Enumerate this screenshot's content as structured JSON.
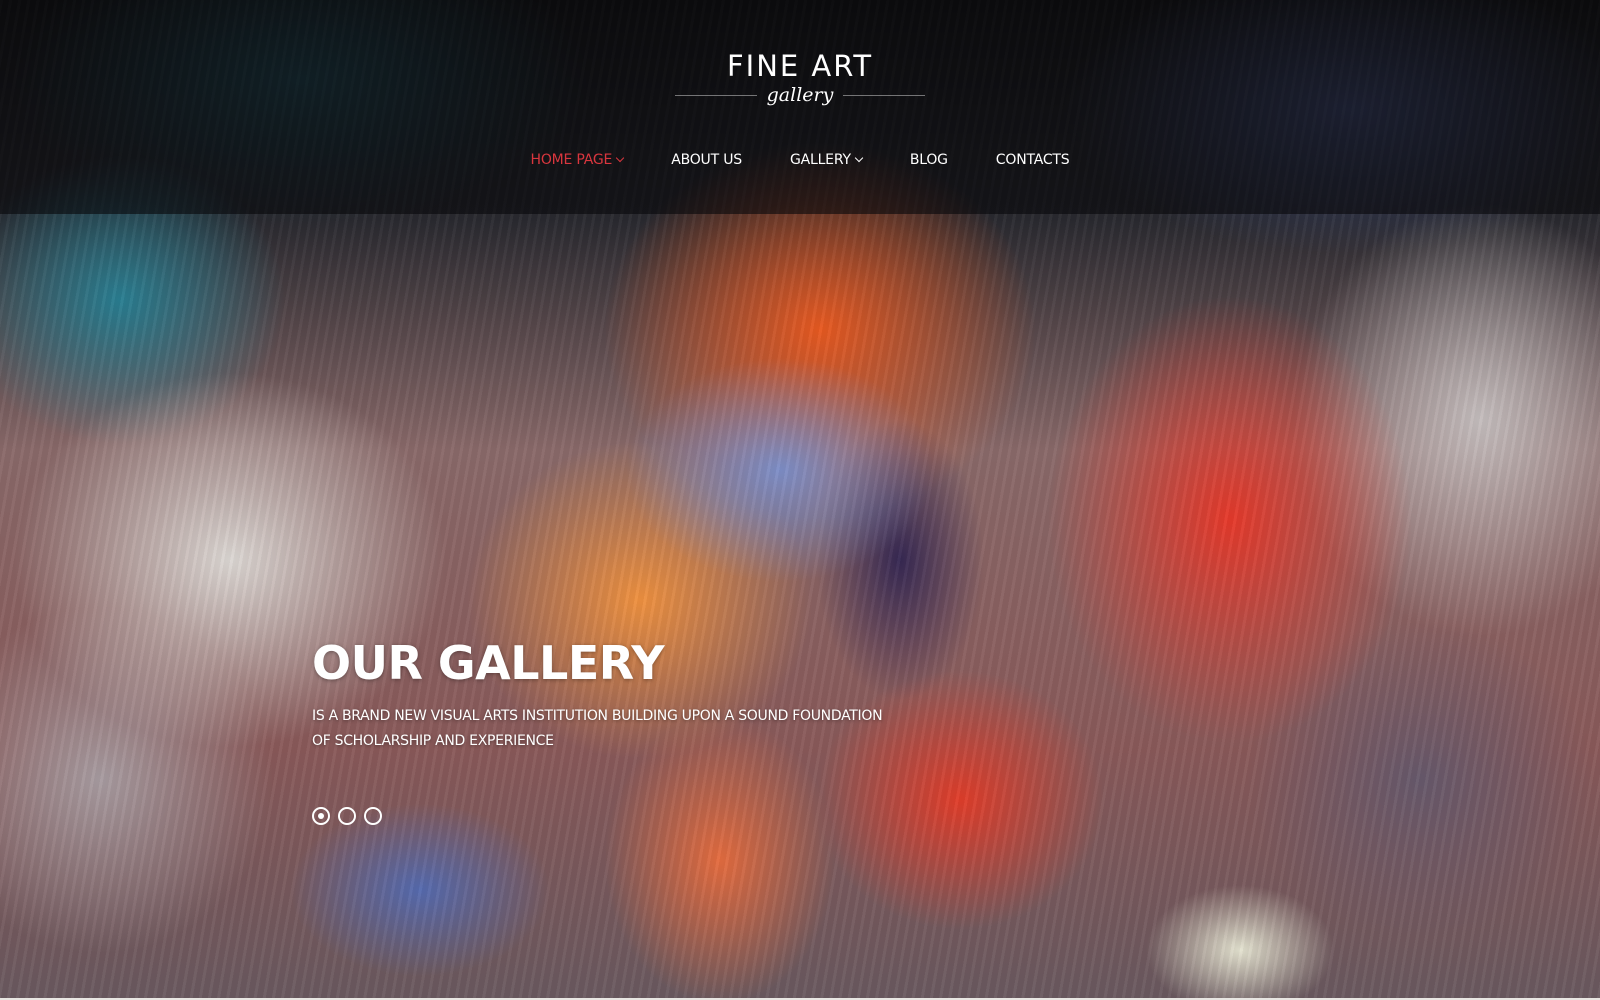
{
  "brand": {
    "title": "FINE ART",
    "subtitle": "gallery"
  },
  "colors": {
    "accent": "#d9363e",
    "nav_text": "#ffffff",
    "header_overlay": "rgba(8,8,12,0.62)"
  },
  "nav": {
    "items": [
      {
        "label": "HOME PAGE",
        "active": true,
        "has_dropdown": true,
        "icon": "chevron-down-icon"
      },
      {
        "label": "ABOUT US",
        "active": false,
        "has_dropdown": false
      },
      {
        "label": "GALLERY",
        "active": false,
        "has_dropdown": true,
        "icon": "chevron-down-icon"
      },
      {
        "label": "BLOG",
        "active": false,
        "has_dropdown": false
      },
      {
        "label": "CONTACTS",
        "active": false,
        "has_dropdown": false
      }
    ]
  },
  "hero": {
    "title": "OUR GALLERY",
    "subtitle_line1": "IS A BRAND NEW VISUAL ARTS INSTITUTION BUILDING UPON A SOUND FOUNDATION",
    "subtitle_line2": "OF SCHOLARSHIP AND EXPERIENCE",
    "background": "abstract colorful paint explosion artwork"
  },
  "slider": {
    "slide_count": 3,
    "active_index": 0
  }
}
